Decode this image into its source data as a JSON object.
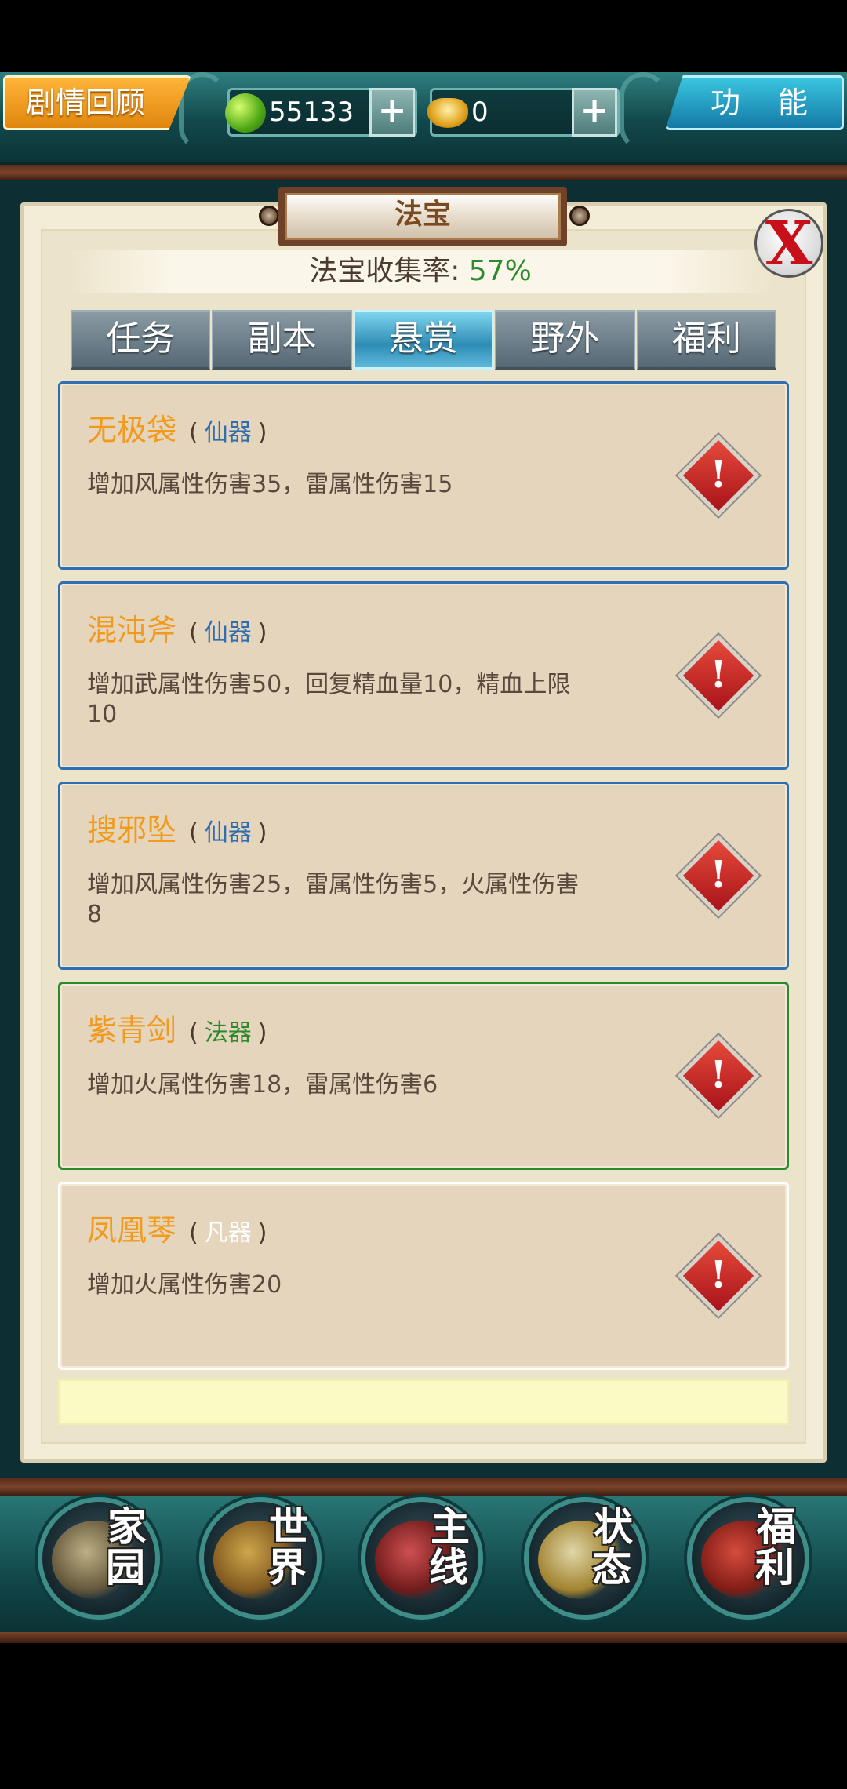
{
  "header": {
    "story_label": "剧情回顾",
    "jade_amount": "55133",
    "gold_amount": "0",
    "plus": "+",
    "function_label": "功 能"
  },
  "panel": {
    "title": "法宝",
    "collect_label": "法宝收集率: ",
    "collect_pct": "57%",
    "close_glyph": "X"
  },
  "tabs": [
    {
      "label": "任务"
    },
    {
      "label": "副本"
    },
    {
      "label": "悬赏",
      "active": true
    },
    {
      "label": "野外"
    },
    {
      "label": "福利"
    }
  ],
  "items": [
    {
      "name": "无极袋",
      "grade": "仙器",
      "desc": "增加风属性伤害35，雷属性伤害15",
      "alert": "!"
    },
    {
      "name": "混沌斧",
      "grade": "仙器",
      "desc": "增加武属性伤害50，回复精血量10，精血上限10",
      "alert": "!"
    },
    {
      "name": "搜邪坠",
      "grade": "仙器",
      "desc": "增加风属性伤害25，雷属性伤害5，火属性伤害8",
      "alert": "!"
    },
    {
      "name": "紫青剑",
      "grade": "法器",
      "desc": "增加火属性伤害18，雷属性伤害6",
      "alert": "!"
    },
    {
      "name": "凤凰琴",
      "grade": "凡器",
      "desc": "增加火属性伤害20",
      "alert": "!"
    }
  ],
  "bracket_open": "(",
  "bracket_close": ")",
  "nav": [
    {
      "c1": "家",
      "c2": "园"
    },
    {
      "c1": "世",
      "c2": "界"
    },
    {
      "c1": "主",
      "c2": "线"
    },
    {
      "c1": "状",
      "c2": "态"
    },
    {
      "c1": "福",
      "c2": "利"
    }
  ],
  "colors": {
    "item_name": "#f29a1c",
    "grade_xianqi": "#2e6eb0",
    "grade_faqi": "#2c8a2c",
    "grade_fanqi": "#ffffff",
    "collect_pct": "#2f8a2c",
    "tab_active": "#2e8db5"
  },
  "icons": {
    "jade": "jade-coin-icon",
    "gold": "gold-ingot-icon",
    "close": "close-x-icon",
    "alert": "exclamation-diamond-icon"
  }
}
